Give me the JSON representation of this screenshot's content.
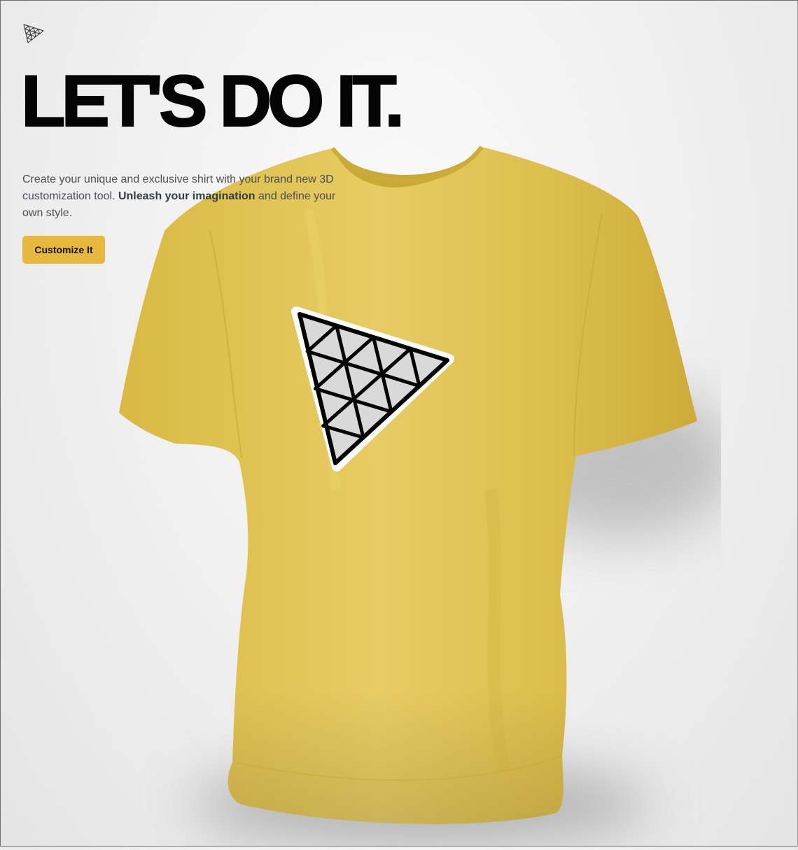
{
  "hero": {
    "title": "LET'S DO IT.",
    "description_part1": "Create your unique and exclusive shirt with your brand new 3D customization tool.",
    "description_strong": "Unleash your imagination",
    "description_part2": "and define your own style.",
    "cta_label": "Customize It"
  },
  "icons": {
    "logo": "threejs-triangle-logo",
    "decal": "threejs-triangle-logo"
  },
  "colors": {
    "shirt": "#e5c658",
    "accent": "#e6b83d",
    "decal_fill": "#d9d9d9",
    "decal_stroke": "#000000"
  }
}
